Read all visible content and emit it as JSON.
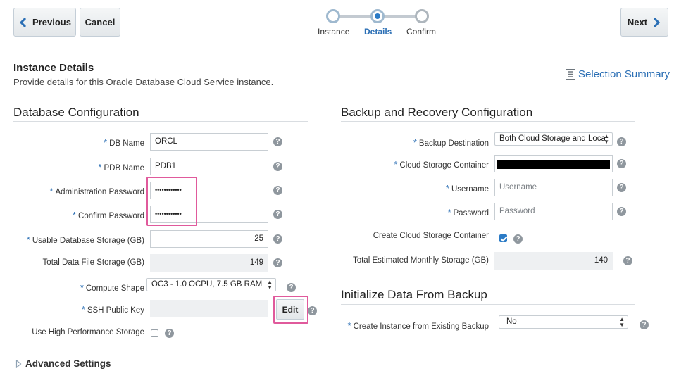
{
  "nav": {
    "previous_label": "Previous",
    "cancel_label": "Cancel",
    "next_label": "Next"
  },
  "train": {
    "steps": [
      "Instance",
      "Details",
      "Confirm"
    ],
    "active_index": 1
  },
  "header": {
    "title": "Instance Details",
    "subtitle": "Provide details for this Oracle Database Cloud Service instance.",
    "summary_link": "Selection Summary"
  },
  "db_config": {
    "title": "Database Configuration",
    "db_name_label": "DB Name",
    "db_name_value": "ORCL",
    "pdb_name_label": "PDB Name",
    "pdb_name_value": "PDB1",
    "admin_pw_label": "Administration Password",
    "admin_pw_value": "••••••••••••",
    "confirm_pw_label": "Confirm Password",
    "confirm_pw_value": "••••••••••••",
    "usable_storage_label": "Usable Database Storage (GB)",
    "usable_storage_value": "25",
    "total_file_storage_label": "Total Data File Storage (GB)",
    "total_file_storage_value": "149",
    "compute_shape_label": "Compute Shape",
    "compute_shape_value": "OC3 - 1.0 OCPU, 7.5 GB RAM",
    "ssh_key_label": "SSH Public Key",
    "ssh_key_value": "",
    "edit_label": "Edit",
    "high_perf_label": "Use High Performance Storage",
    "high_perf_checked": false
  },
  "backup_config": {
    "title": "Backup and Recovery Configuration",
    "destination_label": "Backup Destination",
    "destination_value": "Both Cloud Storage and Loca",
    "container_label": "Cloud Storage Container",
    "username_label": "Username",
    "username_placeholder": "Username",
    "password_label": "Password",
    "password_placeholder": "Password",
    "create_container_label": "Create Cloud Storage Container",
    "create_container_checked": true,
    "monthly_storage_label": "Total Estimated Monthly Storage (GB)",
    "monthly_storage_value": "140"
  },
  "init_backup": {
    "title": "Initialize Data From Backup",
    "create_from_backup_label": "Create Instance from Existing Backup",
    "create_from_backup_value": "No"
  },
  "advanced": {
    "label": "Advanced Settings"
  },
  "icons": {
    "help_glyph": "?",
    "required_glyph": "*"
  },
  "colors": {
    "accent": "#2b7bc6",
    "highlight": "#e05a9c",
    "link": "#2b6fb5"
  }
}
